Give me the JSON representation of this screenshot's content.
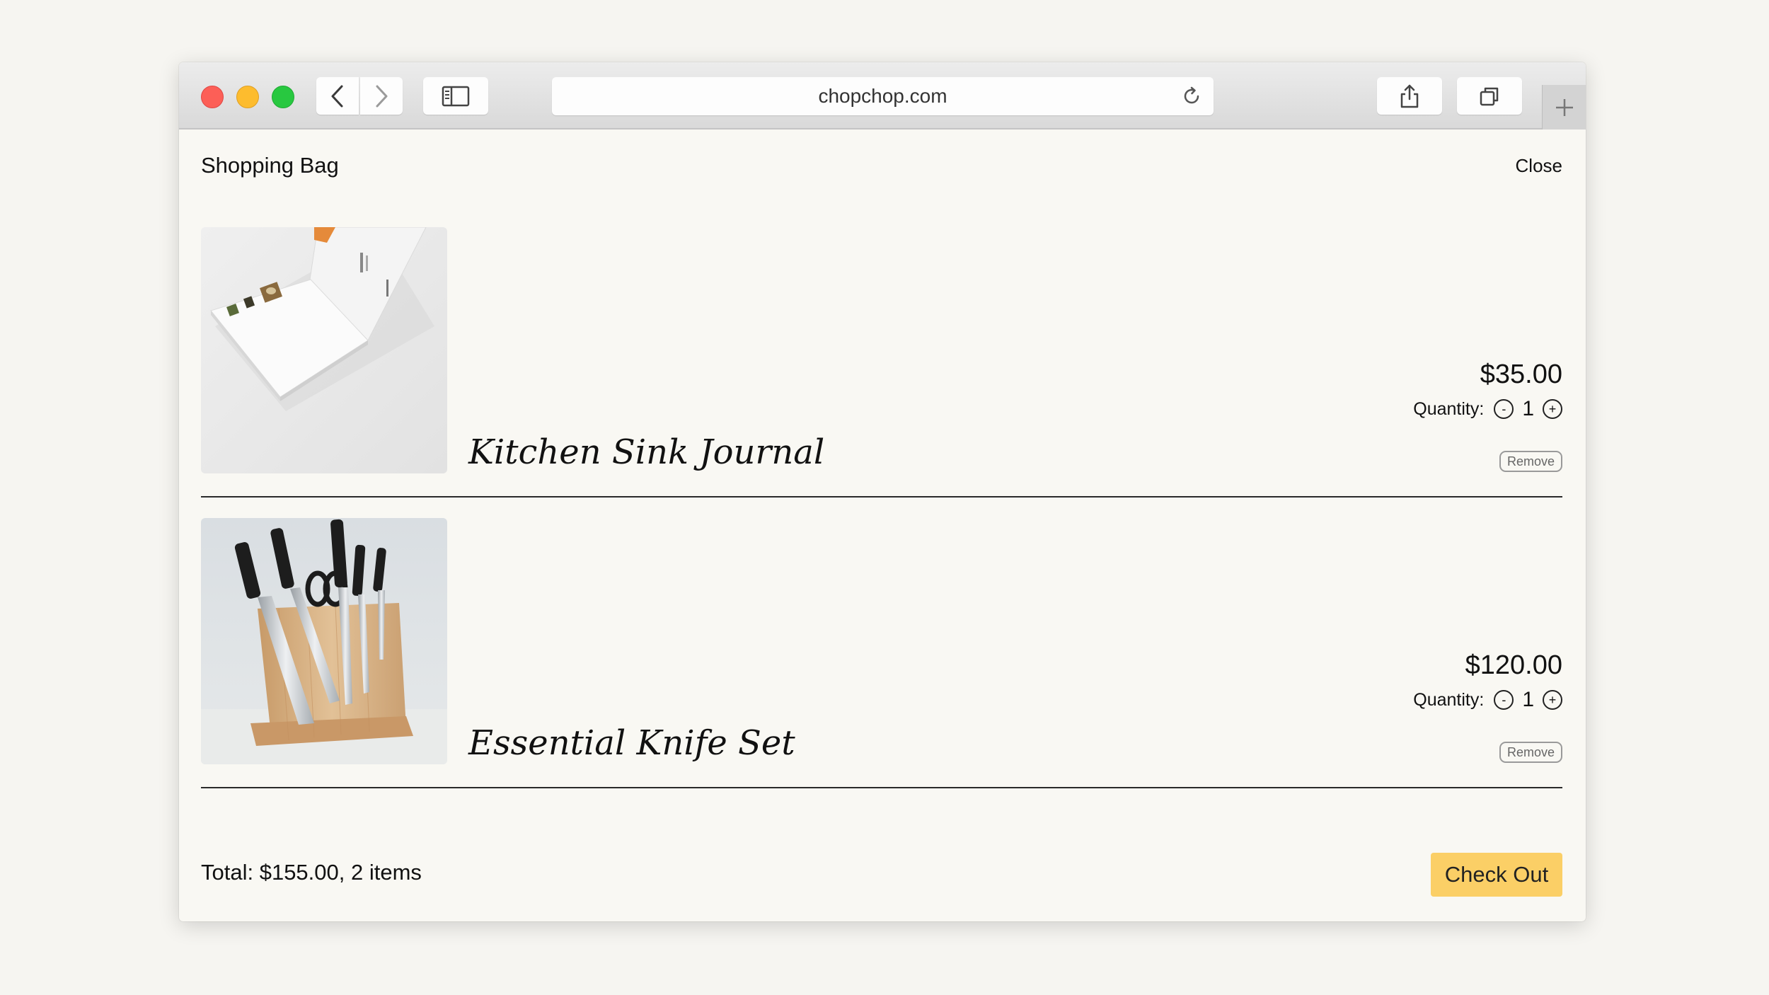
{
  "browser": {
    "url": "chopchop.com",
    "traffic_lights": {
      "close": "#fc5f57",
      "minimize": "#fdbc2e",
      "zoom": "#28c840"
    }
  },
  "bag": {
    "title": "Shopping Bag",
    "close_label": "Close",
    "quantity_label": "Quantity:",
    "decrement_label": "-",
    "increment_label": "+",
    "remove_label": "Remove",
    "items": [
      {
        "name": "Kitchen Sink Journal",
        "price": "$35.00",
        "quantity": "1",
        "image": "journal-photo"
      },
      {
        "name": "Essential Knife Set",
        "price": "$120.00",
        "quantity": "1",
        "image": "knife-set-photo"
      }
    ],
    "total": "Total: $155.00, 2 items",
    "checkout_label": "Check Out",
    "accent_color": "#fbcf66"
  }
}
